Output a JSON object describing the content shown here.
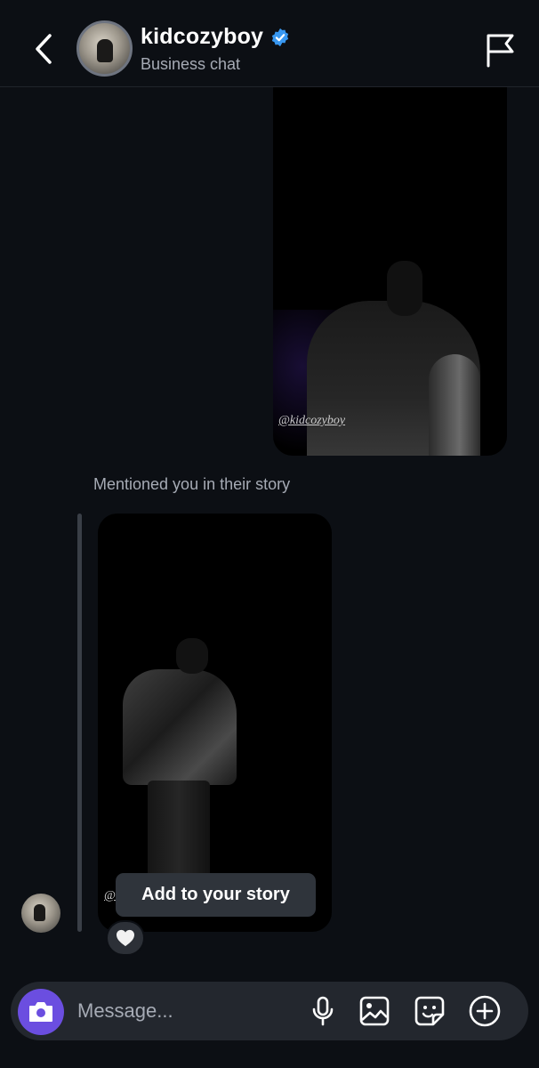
{
  "header": {
    "username": "kidcozyboy",
    "subtitle": "Business chat",
    "verified": true,
    "icons": {
      "back": "chevron-left-icon",
      "report": "flag-icon",
      "verified": "verified-badge-icon"
    }
  },
  "messages": {
    "story_tag_1": "@kidcozyboy",
    "mention_label": "Mentioned you in their story",
    "story_tag_2": "@",
    "tooltip": "Add to your story",
    "reaction_icon": "heart-icon"
  },
  "composer": {
    "placeholder": "Message...",
    "icons": [
      "camera-icon",
      "microphone-icon",
      "gallery-icon",
      "sticker-icon",
      "plus-circle-icon"
    ]
  },
  "colors": {
    "background": "#0c0f14",
    "accent_camera": "#6b4ee0",
    "verified_blue": "#3897f0",
    "muted_text": "#a6abb5"
  }
}
